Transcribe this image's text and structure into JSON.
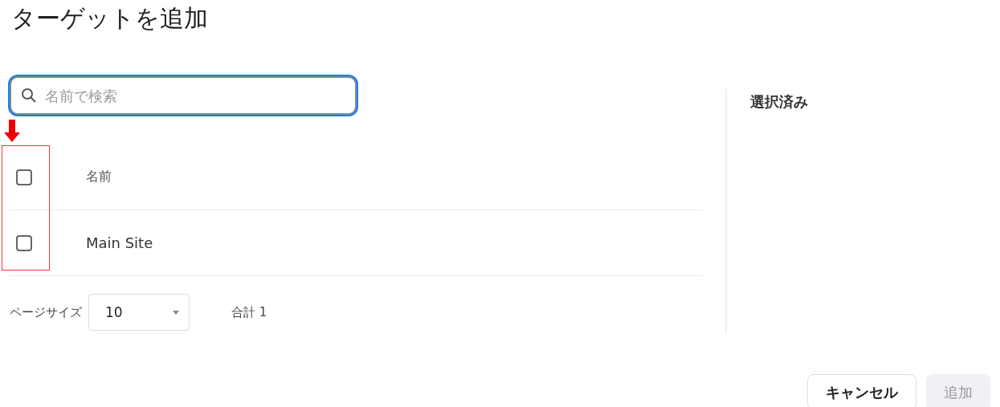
{
  "title": "ターゲットを追加",
  "search": {
    "placeholder": "名前で検索",
    "focused": true
  },
  "table": {
    "header": {
      "label": "名前",
      "checked": false
    },
    "rows": [
      {
        "name": "Main Site",
        "checked": false
      }
    ]
  },
  "pagination": {
    "page_size_label": "ページサイズ",
    "page_size": "10",
    "total": "合計 1"
  },
  "selected_panel": {
    "title": "選択済み"
  },
  "buttons": [
    {
      "label": "キャンセル",
      "kind": "secondary",
      "disabled": false
    },
    {
      "label": "追加",
      "kind": "primary",
      "disabled": true
    }
  ]
}
